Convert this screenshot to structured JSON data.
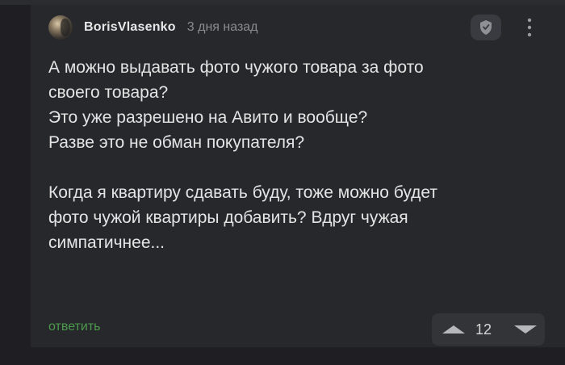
{
  "comment": {
    "author": "BorisVlasenko",
    "timestamp": "3 дня назад",
    "paragraphs": [
      [
        "А можно выдавать фото чужого товара за фото",
        "своего товара?",
        "Это уже разрешено на Авито и вообще?",
        "Разве это не обман покупателя?"
      ],
      [
        "Когда я квартиру сдавать буду, тоже можно будет",
        "фото чужой квартиры добавить? Вдруг чужая",
        "симпатичнее..."
      ]
    ],
    "reply_label": "ответить",
    "rating": "12"
  },
  "icons": {
    "avatar": "user-avatar",
    "moderation": "shield-icon",
    "menu": "more-vertical-icon",
    "upvote": "triangle-up-icon",
    "downvote": "triangle-down-icon"
  },
  "colors": {
    "background": "#1f1f23",
    "card": "#27282c",
    "text": "#e4e4e4",
    "muted": "#8b8c90",
    "reply": "#4c9a4c"
  }
}
